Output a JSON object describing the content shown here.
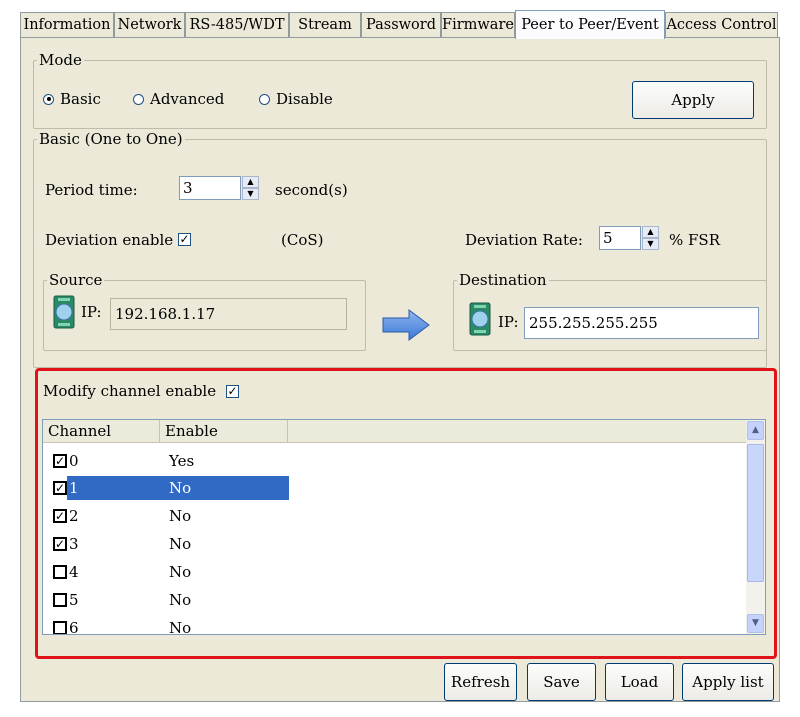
{
  "tabs": [
    "Information",
    "Network",
    "RS-485/WDT",
    "Stream",
    "Password",
    "Firmware",
    "Peer to Peer/Event",
    "Access Control"
  ],
  "mode": {
    "legend": "Mode",
    "options": [
      "Basic",
      "Advanced",
      "Disable"
    ],
    "selected": "Basic",
    "apply_label": "Apply"
  },
  "basic": {
    "legend": "Basic (One to One)",
    "period_label": "Period time:",
    "period_value": "3",
    "period_unit": "second(s)",
    "deviation_enable_label": "Deviation enable",
    "deviation_enable_checked": true,
    "cos_label": "(CoS)",
    "deviation_rate_label": "Deviation Rate:",
    "deviation_rate_value": "5",
    "deviation_rate_unit": "% FSR",
    "source": {
      "legend": "Source",
      "ip_label": "IP:",
      "ip_value": "192.168.1.17"
    },
    "destination": {
      "legend": "Destination",
      "ip_label": "IP:",
      "ip_value": "255.255.255.255"
    }
  },
  "modify": {
    "label": "Modify channel enable",
    "checked": true,
    "columns": [
      "Channel",
      "Enable"
    ],
    "rows": [
      {
        "channel": "0",
        "enable": "Yes",
        "checked": true
      },
      {
        "channel": "1",
        "enable": "No",
        "checked": true,
        "selected": true
      },
      {
        "channel": "2",
        "enable": "No",
        "checked": true
      },
      {
        "channel": "3",
        "enable": "No",
        "checked": true
      },
      {
        "channel": "4",
        "enable": "No",
        "checked": false
      },
      {
        "channel": "5",
        "enable": "No",
        "checked": false
      },
      {
        "channel": "6",
        "enable": "No",
        "checked": false
      }
    ]
  },
  "buttons": {
    "refresh": "Refresh",
    "save": "Save",
    "load": "Load",
    "apply_list": "Apply list"
  },
  "colors": {
    "panel": "#ece9d8",
    "highlight": "#e0131b",
    "selection": "#316ac5"
  },
  "icons": {
    "arrow": "right-arrow-icon",
    "module": "adam-module-icon"
  }
}
